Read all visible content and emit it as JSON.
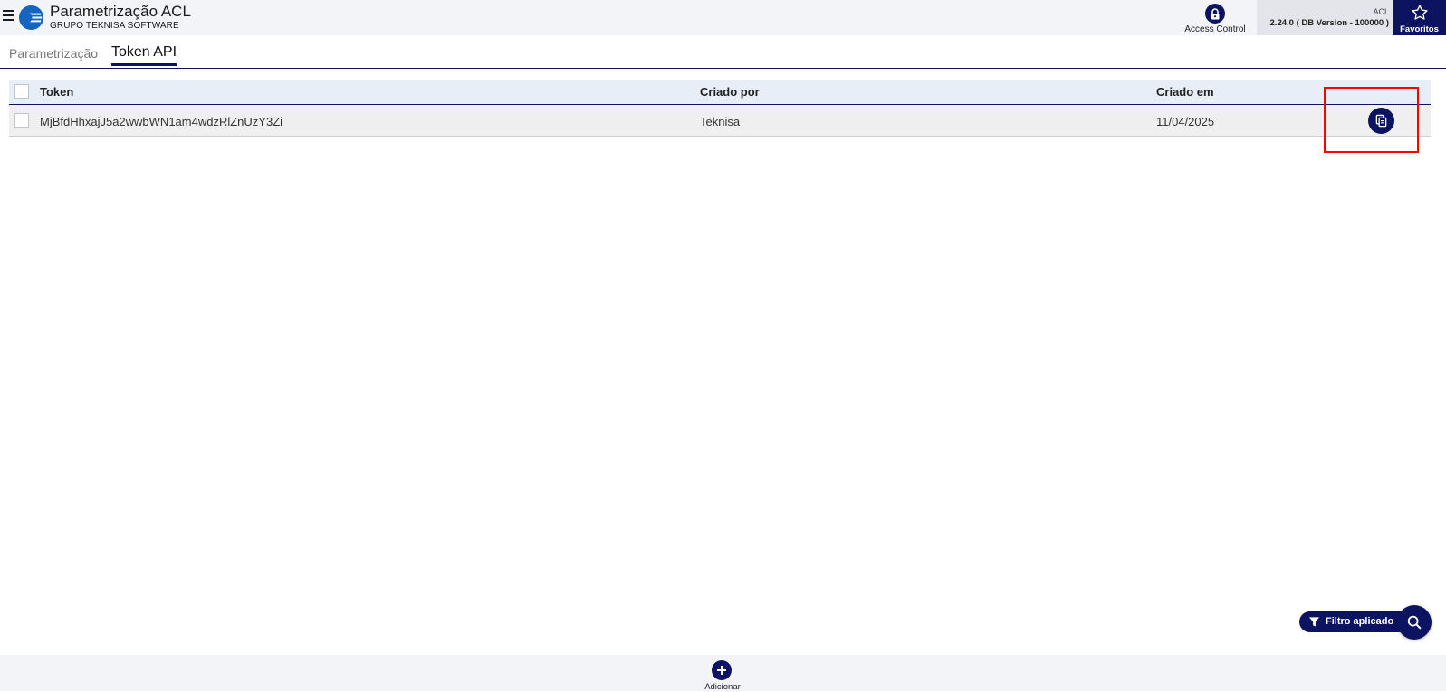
{
  "header": {
    "title": "Parametrização ACL",
    "subtitle": "GRUPO TEKNISA SOFTWARE",
    "access_control_label": "Access Control",
    "acl_label": "ACL",
    "version": "2.24.0 ( DB Version - 100000 )",
    "favoritos_label": "Favoritos"
  },
  "tabs": [
    {
      "label": "Parametrização",
      "active": false
    },
    {
      "label": "Token API",
      "active": true
    }
  ],
  "grid": {
    "columns": [
      "Token",
      "Criado por",
      "Criado em"
    ],
    "rows": [
      {
        "token": "MjBfdHhxajJ5a2wwbWN1am4wdzRlZnUzY3Zi",
        "criado_por": "Teknisa",
        "criado_em": "11/04/2025"
      }
    ]
  },
  "filter": {
    "label": "Filtro aplicado"
  },
  "footer": {
    "add_label": "Adicionar"
  },
  "colors": {
    "primary": "#0c1462",
    "highlight": "#ff0000",
    "header_bg": "#f2f4f8"
  }
}
